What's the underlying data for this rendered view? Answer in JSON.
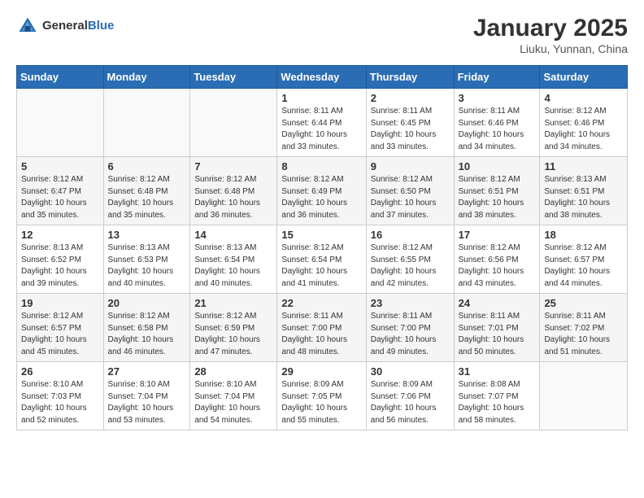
{
  "header": {
    "logo_general": "General",
    "logo_blue": "Blue",
    "month_title": "January 2025",
    "location": "Liuku, Yunnan, China"
  },
  "weekdays": [
    "Sunday",
    "Monday",
    "Tuesday",
    "Wednesday",
    "Thursday",
    "Friday",
    "Saturday"
  ],
  "weeks": [
    [
      {
        "day": "",
        "info": ""
      },
      {
        "day": "",
        "info": ""
      },
      {
        "day": "",
        "info": ""
      },
      {
        "day": "1",
        "info": "Sunrise: 8:11 AM\nSunset: 6:44 PM\nDaylight: 10 hours\nand 33 minutes."
      },
      {
        "day": "2",
        "info": "Sunrise: 8:11 AM\nSunset: 6:45 PM\nDaylight: 10 hours\nand 33 minutes."
      },
      {
        "day": "3",
        "info": "Sunrise: 8:11 AM\nSunset: 6:46 PM\nDaylight: 10 hours\nand 34 minutes."
      },
      {
        "day": "4",
        "info": "Sunrise: 8:12 AM\nSunset: 6:46 PM\nDaylight: 10 hours\nand 34 minutes."
      }
    ],
    [
      {
        "day": "5",
        "info": "Sunrise: 8:12 AM\nSunset: 6:47 PM\nDaylight: 10 hours\nand 35 minutes."
      },
      {
        "day": "6",
        "info": "Sunrise: 8:12 AM\nSunset: 6:48 PM\nDaylight: 10 hours\nand 35 minutes."
      },
      {
        "day": "7",
        "info": "Sunrise: 8:12 AM\nSunset: 6:48 PM\nDaylight: 10 hours\nand 36 minutes."
      },
      {
        "day": "8",
        "info": "Sunrise: 8:12 AM\nSunset: 6:49 PM\nDaylight: 10 hours\nand 36 minutes."
      },
      {
        "day": "9",
        "info": "Sunrise: 8:12 AM\nSunset: 6:50 PM\nDaylight: 10 hours\nand 37 minutes."
      },
      {
        "day": "10",
        "info": "Sunrise: 8:12 AM\nSunset: 6:51 PM\nDaylight: 10 hours\nand 38 minutes."
      },
      {
        "day": "11",
        "info": "Sunrise: 8:13 AM\nSunset: 6:51 PM\nDaylight: 10 hours\nand 38 minutes."
      }
    ],
    [
      {
        "day": "12",
        "info": "Sunrise: 8:13 AM\nSunset: 6:52 PM\nDaylight: 10 hours\nand 39 minutes."
      },
      {
        "day": "13",
        "info": "Sunrise: 8:13 AM\nSunset: 6:53 PM\nDaylight: 10 hours\nand 40 minutes."
      },
      {
        "day": "14",
        "info": "Sunrise: 8:13 AM\nSunset: 6:54 PM\nDaylight: 10 hours\nand 40 minutes."
      },
      {
        "day": "15",
        "info": "Sunrise: 8:12 AM\nSunset: 6:54 PM\nDaylight: 10 hours\nand 41 minutes."
      },
      {
        "day": "16",
        "info": "Sunrise: 8:12 AM\nSunset: 6:55 PM\nDaylight: 10 hours\nand 42 minutes."
      },
      {
        "day": "17",
        "info": "Sunrise: 8:12 AM\nSunset: 6:56 PM\nDaylight: 10 hours\nand 43 minutes."
      },
      {
        "day": "18",
        "info": "Sunrise: 8:12 AM\nSunset: 6:57 PM\nDaylight: 10 hours\nand 44 minutes."
      }
    ],
    [
      {
        "day": "19",
        "info": "Sunrise: 8:12 AM\nSunset: 6:57 PM\nDaylight: 10 hours\nand 45 minutes."
      },
      {
        "day": "20",
        "info": "Sunrise: 8:12 AM\nSunset: 6:58 PM\nDaylight: 10 hours\nand 46 minutes."
      },
      {
        "day": "21",
        "info": "Sunrise: 8:12 AM\nSunset: 6:59 PM\nDaylight: 10 hours\nand 47 minutes."
      },
      {
        "day": "22",
        "info": "Sunrise: 8:11 AM\nSunset: 7:00 PM\nDaylight: 10 hours\nand 48 minutes."
      },
      {
        "day": "23",
        "info": "Sunrise: 8:11 AM\nSunset: 7:00 PM\nDaylight: 10 hours\nand 49 minutes."
      },
      {
        "day": "24",
        "info": "Sunrise: 8:11 AM\nSunset: 7:01 PM\nDaylight: 10 hours\nand 50 minutes."
      },
      {
        "day": "25",
        "info": "Sunrise: 8:11 AM\nSunset: 7:02 PM\nDaylight: 10 hours\nand 51 minutes."
      }
    ],
    [
      {
        "day": "26",
        "info": "Sunrise: 8:10 AM\nSunset: 7:03 PM\nDaylight: 10 hours\nand 52 minutes."
      },
      {
        "day": "27",
        "info": "Sunrise: 8:10 AM\nSunset: 7:04 PM\nDaylight: 10 hours\nand 53 minutes."
      },
      {
        "day": "28",
        "info": "Sunrise: 8:10 AM\nSunset: 7:04 PM\nDaylight: 10 hours\nand 54 minutes."
      },
      {
        "day": "29",
        "info": "Sunrise: 8:09 AM\nSunset: 7:05 PM\nDaylight: 10 hours\nand 55 minutes."
      },
      {
        "day": "30",
        "info": "Sunrise: 8:09 AM\nSunset: 7:06 PM\nDaylight: 10 hours\nand 56 minutes."
      },
      {
        "day": "31",
        "info": "Sunrise: 8:08 AM\nSunset: 7:07 PM\nDaylight: 10 hours\nand 58 minutes."
      },
      {
        "day": "",
        "info": ""
      }
    ]
  ]
}
